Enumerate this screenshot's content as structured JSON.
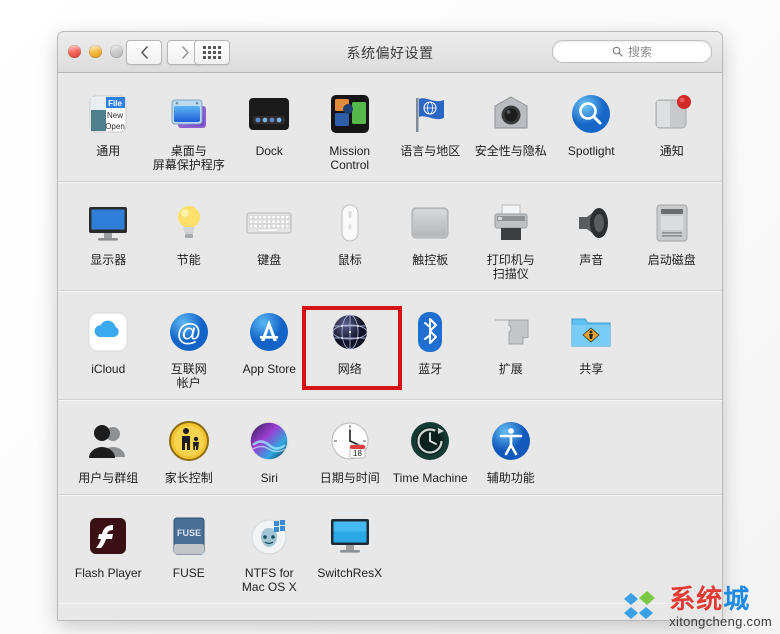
{
  "window": {
    "title": "系统偏好设置",
    "traffic_lights": [
      "close",
      "minimize",
      "zoom"
    ],
    "nav": {
      "back": "back-chevron",
      "forward": "forward-chevron",
      "show_all": "show-all-grid"
    },
    "search": {
      "placeholder": "搜索",
      "value": ""
    }
  },
  "highlight": {
    "target": "网络",
    "color": "#d61317"
  },
  "rows": [
    {
      "panes": [
        {
          "label": "通用",
          "icon": "general-icon"
        },
        {
          "label": "桌面与\n屏幕保护程序",
          "icon": "desktop-screensaver-icon"
        },
        {
          "label": "Dock",
          "icon": "dock-icon"
        },
        {
          "label": "Mission\nControl",
          "icon": "mission-control-icon"
        },
        {
          "label": "语言与地区",
          "icon": "language-region-icon"
        },
        {
          "label": "安全性与隐私",
          "icon": "security-privacy-icon"
        },
        {
          "label": "Spotlight",
          "icon": "spotlight-icon"
        },
        {
          "label": "通知",
          "icon": "notifications-icon",
          "badge": true
        }
      ]
    },
    {
      "panes": [
        {
          "label": "显示器",
          "icon": "displays-icon"
        },
        {
          "label": "节能",
          "icon": "energy-saver-icon"
        },
        {
          "label": "键盘",
          "icon": "keyboard-icon"
        },
        {
          "label": "鼠标",
          "icon": "mouse-icon"
        },
        {
          "label": "触控板",
          "icon": "trackpad-icon"
        },
        {
          "label": "打印机与\n扫描仪",
          "icon": "printers-scanners-icon"
        },
        {
          "label": "声音",
          "icon": "sound-icon"
        },
        {
          "label": "启动磁盘",
          "icon": "startup-disk-icon"
        }
      ]
    },
    {
      "panes": [
        {
          "label": "iCloud",
          "icon": "icloud-icon"
        },
        {
          "label": "互联网\n帐户",
          "icon": "internet-accounts-icon"
        },
        {
          "label": "App Store",
          "icon": "app-store-icon"
        },
        {
          "label": "网络",
          "icon": "network-icon"
        },
        {
          "label": "蓝牙",
          "icon": "bluetooth-icon"
        },
        {
          "label": "扩展",
          "icon": "extensions-icon"
        },
        {
          "label": "共享",
          "icon": "sharing-icon"
        }
      ]
    },
    {
      "panes": [
        {
          "label": "用户与群组",
          "icon": "users-groups-icon"
        },
        {
          "label": "家长控制",
          "icon": "parental-controls-icon"
        },
        {
          "label": "Siri",
          "icon": "siri-icon"
        },
        {
          "label": "日期与时间",
          "icon": "date-time-icon"
        },
        {
          "label": "Time Machine",
          "icon": "time-machine-icon"
        },
        {
          "label": "辅助功能",
          "icon": "accessibility-icon"
        }
      ]
    },
    {
      "panes": [
        {
          "label": "Flash Player",
          "icon": "flash-player-icon"
        },
        {
          "label": "FUSE",
          "icon": "fuse-icon"
        },
        {
          "label": "NTFS for\nMac OS X",
          "icon": "ntfs-icon"
        },
        {
          "label": "SwitchResX",
          "icon": "switchresx-icon"
        }
      ]
    }
  ],
  "watermark": {
    "cn_red": "系统",
    "cn_blue": "城",
    "url": "xitongcheng.com"
  }
}
